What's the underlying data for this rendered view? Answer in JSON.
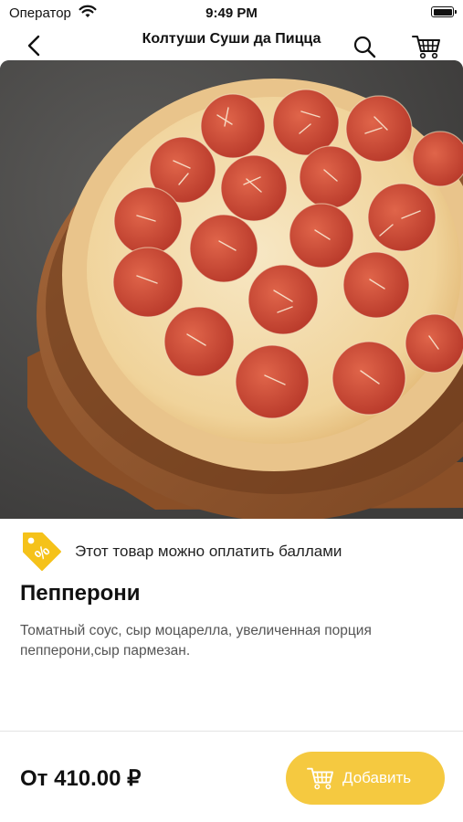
{
  "status_bar": {
    "carrier": "Оператор",
    "time": "9:49 PM"
  },
  "nav": {
    "title": "Колтуши Суши да Пицца",
    "icons": [
      "back-chevron-icon",
      "search-icon",
      "cart-icon"
    ]
  },
  "product": {
    "points_note": "Этот товар можно оплатить баллами",
    "name": "Пепперони",
    "description": "Томатный соус, сыр моцарелла, увеличенная порция пепперони,сыр пармезан."
  },
  "footer": {
    "price": "От 410.00 ₽",
    "add_label": "Добавить"
  },
  "colors": {
    "accent": "#f5c940",
    "tag": "#f5c21a",
    "text": "#111111",
    "muted": "#555555"
  }
}
